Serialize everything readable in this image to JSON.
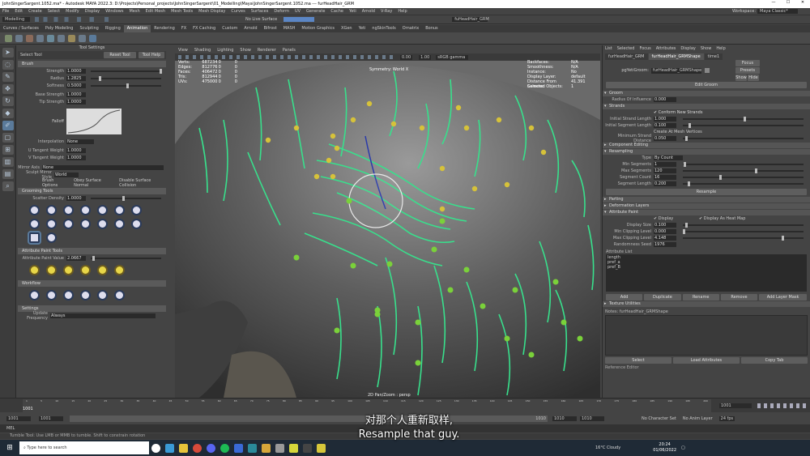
{
  "window": {
    "title": "JohnSingerSargent.1052.ma* - Autodesk MAYA 2022.3: D:\\Projects\\Personal_projects\\JohnSingerSargent\\01_Modelling\\Maya\\JohnSingerSargent.1052.ma --- furHeadHair_GRM"
  },
  "menubar": [
    "File",
    "Edit",
    "Create",
    "Select",
    "Modify",
    "Display",
    "Windows",
    "Mesh",
    "Edit Mesh",
    "Mesh Tools",
    "Mesh Display",
    "Curves",
    "Surfaces",
    "Deform",
    "UV",
    "Generate",
    "Cache",
    "Yeti",
    "Arnold",
    "V-Ray",
    "Help"
  ],
  "workspace": {
    "label": "Workspace:",
    "value": "Maya Classic*"
  },
  "statusline": {
    "mode": "Modelling",
    "no_live": "No Live Surface",
    "field": "fuHeadHair_GRM"
  },
  "shelf_tabs": [
    "Curves / Surfaces",
    "Poly Modeling",
    "Sculpting",
    "Rigging",
    "Animation",
    "Rendering",
    "FX",
    "FX Caching",
    "Custom",
    "Arnold",
    "Bifrost",
    "MASH",
    "Motion Graphics",
    "XGen",
    "Yeti",
    "ngSkinTools",
    "Ornatrix",
    "Bonus"
  ],
  "shelf_active": "Animation",
  "tool_settings": {
    "header": "Tool Settings",
    "tool_name": "Select Tool",
    "reset": "Reset Tool",
    "help": "Tool Help",
    "brush": {
      "label": "Brush",
      "strength_label": "Strength",
      "strength": "1.0000",
      "radius_label": "Radius",
      "radius": "1.2825",
      "softness_label": "Softness",
      "softness": "0.5000",
      "base_label": "Base Strength",
      "base": "1.0000",
      "tip_label": "Tip Strength",
      "tip": "1.0000",
      "falloff_label": "Falloff",
      "interp_label": "Interpolation",
      "interp": "None",
      "uw_label": "U Tangent Weight",
      "uw": "1.0000",
      "vw_label": "V Tangent Weight",
      "vw": "1.0000"
    },
    "mirror_label": "Mirror Axis",
    "mirror": "None",
    "sculpt_mirror_label": "Sculpt Mirror Style",
    "sculpt_mirror": "World",
    "brush_options": "Brush Options",
    "obey_surface": "Obey Surface Normal",
    "disable_coll": "Disable Surface Collision",
    "grooming": {
      "label": "Grooming Tools",
      "scatter_label": "Scatter Density",
      "scatter": "1.0000"
    },
    "attr_paint": {
      "label": "Attribute Paint Tools",
      "value_label": "Attribute Paint Value",
      "value": "2.0667"
    },
    "workflow": "Workflow",
    "settings": "Settings",
    "update_label": "Update Frequency",
    "update": "Always"
  },
  "viewport": {
    "menu": [
      "View",
      "Shading",
      "Lighting",
      "Show",
      "Renderer",
      "Panels"
    ],
    "colorspace": "sRGB gamma",
    "exposure": "0.00",
    "gamma": "1.00",
    "hud_left": [
      [
        "Verts:",
        "687234",
        "0",
        "0"
      ],
      [
        "Edges:",
        "812776",
        "0",
        "0"
      ],
      [
        "Faces:",
        "406472",
        "0",
        "0"
      ],
      [
        "Tris:",
        "812944",
        "0",
        "0"
      ],
      [
        "UVs:",
        "475000",
        "0",
        "0"
      ]
    ],
    "hud_right": [
      [
        "Backfaces:",
        "N/A"
      ],
      [
        "Smoothness:",
        "N/A"
      ],
      [
        "Instance:",
        "No"
      ],
      [
        "Display Layer:",
        "default"
      ],
      [
        "Distance From Camera:",
        "41.391"
      ],
      [
        "Selected Objects:",
        "1"
      ]
    ],
    "symmetry": "Symmetry: World X",
    "camera": "2D Pan/Zoom : persp"
  },
  "attr_editor": {
    "menus": [
      "List",
      "Selected",
      "Focus",
      "Attributes",
      "Display",
      "Show",
      "Help"
    ],
    "tabs": [
      "furHeadHair_GRM",
      "furHeadHair_GRMShape",
      "time1"
    ],
    "tab_active": 1,
    "node_label": "pgYetiGroom:",
    "node_value": "furHeadHair_GRMShape",
    "focus": "Focus",
    "presets": "Presets",
    "show": "Show",
    "hide": "Hide",
    "edit_groom": "Edit Groom",
    "groom_sec": "Groom",
    "radius_label": "Radius Of Influence",
    "radius": "0.000",
    "strands_sec": "Strands",
    "conform": "Conform New Strands",
    "init_len_label": "Initial Strand Length",
    "init_len": "1.000",
    "init_seg_label": "Initial Segment Length",
    "init_seg": "0.100",
    "create_vert": "Create At Mesh Vertices",
    "min_len_label": "Minimum Strand Distance",
    "min_len": "0.050",
    "comp_sec": "Component Editing",
    "resamp_sec": "Resampling",
    "type_label": "Type",
    "type": "By Count",
    "min_seg_label": "Min Segments",
    "min_seg": "1",
    "max_seg_label": "Max Segments",
    "max_seg": "120",
    "seg_count_label": "Segment Count",
    "seg_count": "16",
    "seg_len_label": "Segment Length",
    "seg_len": "0.200",
    "resample": "Resample",
    "parting": "Parting",
    "deform": "Deformation Layers",
    "attr_paint_sec": "Attribute Paint",
    "display": "Display",
    "heatmap": "Display As Heat Map",
    "disp_size_label": "Display Size",
    "disp_size": "0.100",
    "min_clip_label": "Min Clipping Level",
    "min_clip": "0.000",
    "max_clip_label": "Max Clipping Level",
    "max_clip": "4.148",
    "rand_label": "Randomness Seed",
    "rand": "1976",
    "attr_list_label": "Attribute List",
    "attr_list": [
      "length",
      "pref_a",
      "pref_B"
    ],
    "add": "Add",
    "duplicate": "Duplicate",
    "rename": "Rename",
    "remove": "Remove",
    "add_mask": "Add Layer Mask",
    "texture_sec": "Texture Utilities",
    "notes": "Notes: furHeadHair_GRMShape",
    "select": "Select",
    "load": "Load Attributes",
    "copy": "Copy Tab",
    "ref_editor": "Reference Editor"
  },
  "timeslider": {
    "ticks": [
      "1",
      "5",
      "10",
      "15",
      "20",
      "25",
      "30",
      "35",
      "40",
      "45",
      "50",
      "55",
      "60",
      "65",
      "70",
      "75",
      "80",
      "85",
      "90",
      "95",
      "100",
      "105",
      "110",
      "115",
      "120",
      "125",
      "130",
      "135",
      "140",
      "145",
      "150",
      "155",
      "160",
      "165",
      "170",
      "175",
      "180",
      "185",
      "190",
      "195",
      "200"
    ],
    "current": "1001",
    "frame_field": "1001"
  },
  "range": {
    "start": "1001",
    "start2": "1001",
    "end_inner": "1010",
    "end2": "1010",
    "end3": "1010",
    "char": "No Character Set",
    "anim_layer": "No Anim Layer",
    "fps": "24 fps"
  },
  "mel": "MEL",
  "help": "Tumble Tool: Use LMB or MMB to tumble. Shift to constrain rotation",
  "subtitle_zh": "对那个人重新取样,",
  "subtitle_en": "Resample that guy.",
  "taskbar": {
    "search": "Type here to search",
    "weather": "16°C Cloudy",
    "time": "20:24",
    "date": "01/06/2022"
  }
}
